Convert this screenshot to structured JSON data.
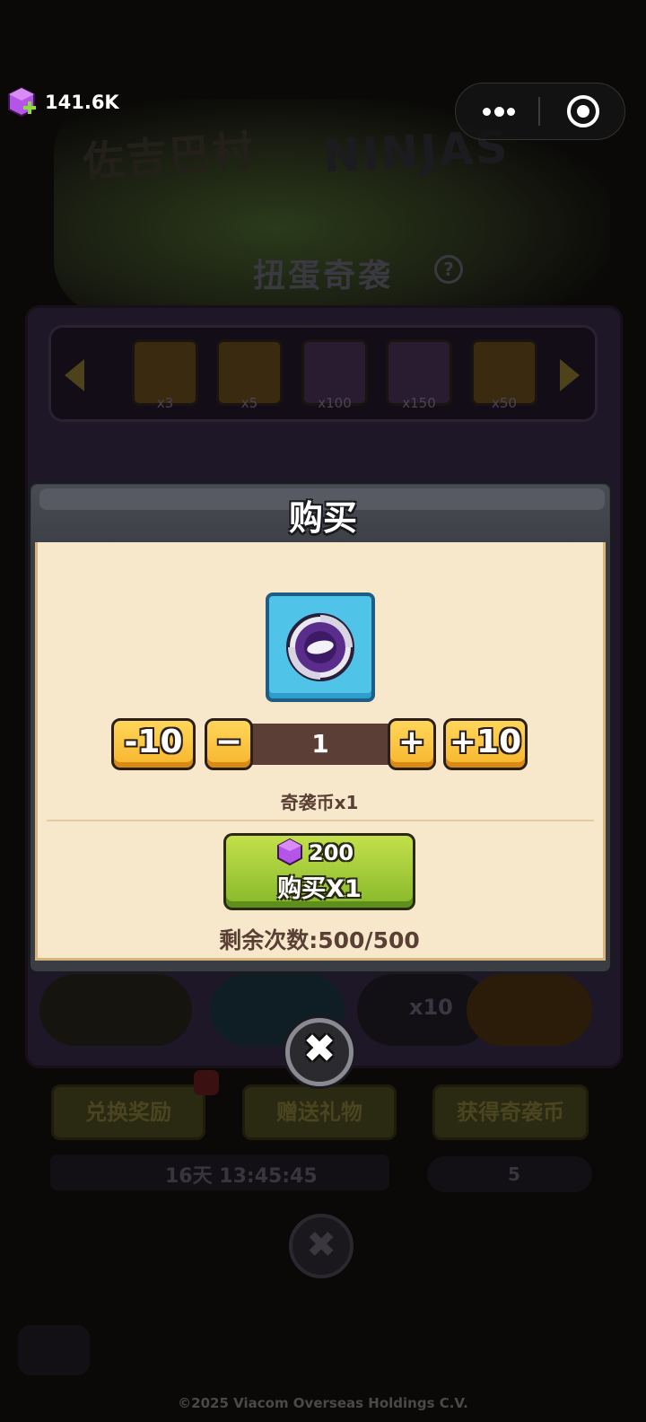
{
  "status": {
    "gem_count": "141.6K",
    "capsule_icons": [
      "more-icon",
      "target-icon"
    ]
  },
  "background": {
    "event_title": "扭蛋奇袭",
    "help_glyph": "?",
    "logo_left": "佐吉巴村",
    "logo_right": "NINJAS",
    "reward_strip": [
      {
        "icon": "fist-badge-icon",
        "qty": "x3"
      },
      {
        "icon": "fist-badge-icon",
        "qty": "x5"
      },
      {
        "icon": "card-icon",
        "qty": "x100"
      },
      {
        "icon": "card-icon",
        "qty": "x150"
      },
      {
        "icon": "gem-icon",
        "qty": "x50"
      }
    ],
    "draw_x10": "x10",
    "buttons": [
      "兑换奖励",
      "赠送礼物",
      "获得奇袭币"
    ],
    "timer": "16天 13:45:45",
    "coin_count": "5",
    "copyright": "©2025 Viacom Overseas Holdings C.V."
  },
  "modal": {
    "title": "购买",
    "item_icon": "raid-coin-icon",
    "minus10": "-10",
    "minus": "−",
    "quantity": "1",
    "plus": "+",
    "plus10": "+10",
    "item_name": "奇袭币x1",
    "price": "200",
    "buy_label": "购买X1",
    "remaining": "剩余次数:500/500",
    "close_glyph": "✖"
  },
  "colors": {
    "modal_body": "#f8e8cb",
    "qty_button": "#f7b52c",
    "buy_button": "#86b82a",
    "item_box": "#4fc3e8",
    "gem": "#b455e8"
  }
}
